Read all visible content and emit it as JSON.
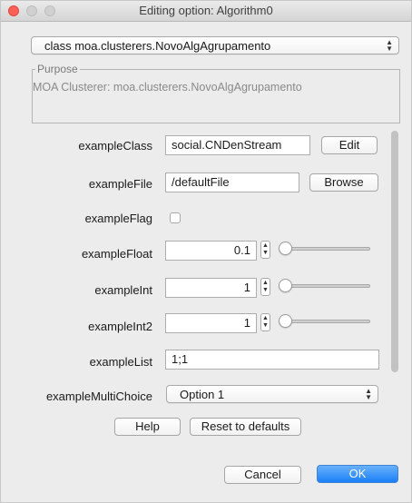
{
  "window": {
    "title": "Editing option: Algorithm0"
  },
  "class_selector": {
    "value": "class moa.clusterers.NovoAlgAgrupamento"
  },
  "purpose": {
    "title": "Purpose",
    "text": "MOA Clusterer: moa.clusterers.NovoAlgAgrupamento"
  },
  "options": {
    "exampleClass": {
      "label": "exampleClass",
      "value": "social.CNDenStream",
      "button": "Edit"
    },
    "exampleFile": {
      "label": "exampleFile",
      "value": "/defaultFile",
      "button": "Browse"
    },
    "exampleFlag": {
      "label": "exampleFlag",
      "checked": false
    },
    "exampleFloat": {
      "label": "exampleFloat",
      "value": "0.1"
    },
    "exampleInt": {
      "label": "exampleInt",
      "value": "1"
    },
    "exampleInt2": {
      "label": "exampleInt2",
      "value": "1"
    },
    "exampleList": {
      "label": "exampleList",
      "value": "1;1"
    },
    "exampleMultiChoice": {
      "label": "exampleMultiChoice",
      "value": "Option 1"
    }
  },
  "buttons": {
    "help": "Help",
    "reset": "Reset to defaults",
    "cancel": "Cancel",
    "ok": "OK"
  },
  "icons": {
    "close": "close-icon",
    "minimize": "minimize-icon",
    "maximize": "maximize-icon",
    "updown_arrows": "updown-arrows-icon"
  },
  "colors": {
    "close": "#fc5f57",
    "primary": "#1b7ff7"
  }
}
